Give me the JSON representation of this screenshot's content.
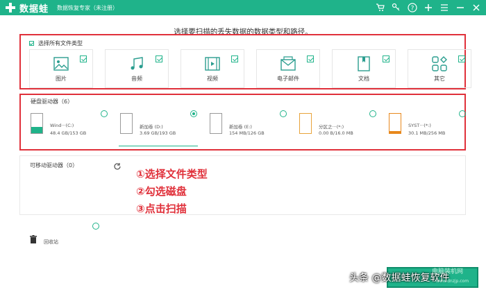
{
  "titlebar": {
    "app_name": "数据蛙",
    "subtitle": "数据恢复专家（未注册）",
    "icons": [
      "cart-icon",
      "key-icon",
      "help-icon",
      "plus-icon",
      "menu-icon",
      "minimize-icon",
      "close-icon"
    ]
  },
  "prompt": "选择要扫描的丢失数据的数据类型和路径。",
  "file_types": {
    "select_all_label": "选择所有文件类型",
    "items": [
      {
        "label": "图片",
        "icon": "image-icon",
        "checked": true
      },
      {
        "label": "音频",
        "icon": "music-icon",
        "checked": true
      },
      {
        "label": "视频",
        "icon": "video-icon",
        "checked": true
      },
      {
        "label": "电子邮件",
        "icon": "email-icon",
        "checked": true
      },
      {
        "label": "文档",
        "icon": "document-icon",
        "checked": true
      },
      {
        "label": "其它",
        "icon": "other-icon",
        "checked": true
      }
    ]
  },
  "hard_drives": {
    "title": "硬盘驱动器（6）",
    "items": [
      {
        "name": "Wind···(C:)",
        "size": "48.4 GB/153 GB",
        "selected": false,
        "fill_color": "#1fb38a",
        "fill_fraction": 0.32
      },
      {
        "name": "新加卷 (D:)",
        "size": "3.69 GB/193 GB",
        "selected": true,
        "fill_color": "#1fb38a",
        "fill_fraction": 0.0
      },
      {
        "name": "新加卷 (E:)",
        "size": "154 MB/126 GB",
        "selected": false,
        "fill_color": "#1fb38a",
        "fill_fraction": 0.0
      },
      {
        "name": "分区之···(*:)",
        "size": "0.00  B/16.0 MB",
        "selected": false,
        "fill_color": "#e8a33a",
        "fill_fraction": 0.0
      },
      {
        "name": "SYST···(*:)",
        "size": "30.1 MB/256 MB",
        "selected": false,
        "fill_color": "#e8881c",
        "fill_fraction": 0.12
      }
    ]
  },
  "removable": {
    "title": "可移动驱动器（0）"
  },
  "annotations": [
    "①选择文件类型",
    "②勾选磁盘",
    "③点击扫描"
  ],
  "recycle_bin": {
    "label": "回收站"
  },
  "watermark": {
    "text": "头条 @数据蛙恢复软件",
    "text2": "电脑装机网",
    "text3": "www.dnzjp.com"
  }
}
